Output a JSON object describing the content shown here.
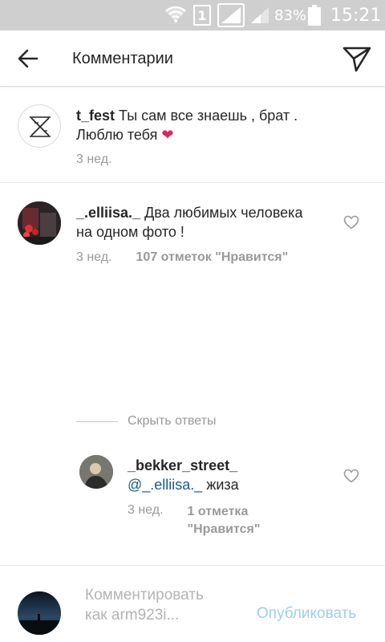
{
  "status_bar": {
    "battery_percent": "83%",
    "sim_label": "1",
    "time": "15:21"
  },
  "app_bar": {
    "title": "Комментарии",
    "back_icon": "arrow-left-icon",
    "send_icon": "paper-plane-icon"
  },
  "caption": {
    "username": "t_fest",
    "text_line1": " Ты сам все знаешь , брат .",
    "text_line2": "Люблю тебя ",
    "emoji": "❤",
    "time": "3 нед."
  },
  "comments": [
    {
      "username": "_.elliisa._",
      "text_line1": " Два любимых человека",
      "text_line2": "на одном фото !",
      "time": "3 нед.",
      "likes": "107 отметок \"Нравится\""
    }
  ],
  "hide_replies_label": "Скрыть ответы",
  "reply": {
    "username": "_bekker_street_",
    "mention": "@_.elliisa._",
    "text": " жиза",
    "time": "3 нед.",
    "likes_line1": "1 отметка",
    "likes_line2": "\"Нравится\""
  },
  "composer": {
    "placeholder_line1": "Комментировать",
    "placeholder_line2": "как arm923i...",
    "publish_label": "Опубликовать"
  },
  "colors": {
    "status_bar_bg": "#cfcfcf",
    "mention": "#1a5a8a",
    "publish_disabled": "#9fcdf2",
    "meta_gray": "#999999"
  }
}
